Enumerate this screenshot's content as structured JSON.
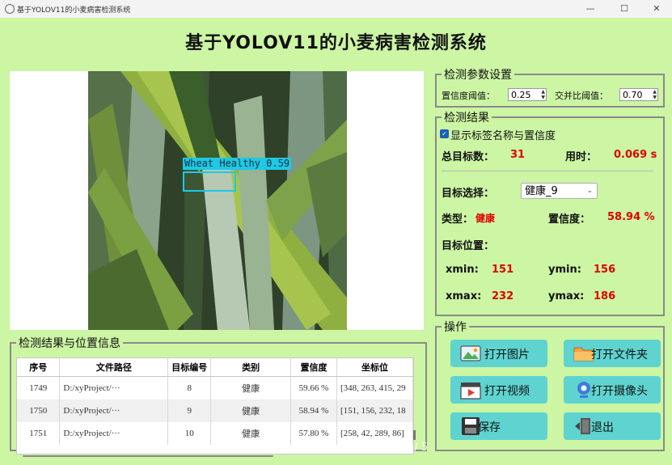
{
  "window": {
    "title": "基于YOLOV11的小麦病害检测系统",
    "min_glyph": "—",
    "max_glyph": "☐",
    "close_glyph": "✕"
  },
  "app": {
    "main_title": "基于YOLOV11的小麦病害检测系统"
  },
  "image": {
    "detection_label": "Wheat Healthy 0.59",
    "box_color": "#1ec8e6"
  },
  "params": {
    "legend": "检测参数设置",
    "conf_label": "置信度阈值：",
    "conf_value": "0.25",
    "iou_label": "交并比阈值：",
    "iou_value": "0.70"
  },
  "results": {
    "legend": "检测结果",
    "show_label_text": "显示标签名称与置信度",
    "show_label_checked": true,
    "total_label": "总目标数：",
    "total_value": "31",
    "time_label": "用时：",
    "time_value": "0.069 s",
    "target_select_label": "目标选择：",
    "target_select_value": "健康_9",
    "type_label": "类型：",
    "type_value": "健康",
    "conf_label": "置信度：",
    "conf_value": "58.94 %",
    "position_label": "目标位置：",
    "xmin_label": "xmin:",
    "xmin_value": "151",
    "ymin_label": "ymin:",
    "ymin_value": "156",
    "xmax_label": "xmax:",
    "xmax_value": "232",
    "ymax_label": "ymax:",
    "ymax_value": "186",
    "accent_color": "#e00000"
  },
  "table": {
    "legend": "检测结果与位置信息",
    "headers": [
      "序号",
      "文件路径",
      "目标编号",
      "类别",
      "置信度",
      "坐标位"
    ],
    "rows": [
      [
        "1749",
        "D:/xyProject/···",
        "8",
        "健康",
        "59.66 %",
        "[348, 263, 415, 29"
      ],
      [
        "1750",
        "D:/xyProject/···",
        "9",
        "健康",
        "58.94 %",
        "[151, 156, 232, 18"
      ],
      [
        "1751",
        "D:/xyProject/···",
        "10",
        "健康",
        "57.80 %",
        "[258, 42, 289, 86]"
      ]
    ]
  },
  "ops": {
    "legend": "操作",
    "open_image": "打开图片",
    "open_folder": "打开文件夹",
    "open_video": "打开视频",
    "open_camera": "打开摄像头",
    "save": "保存",
    "exit": "退出"
  },
  "page_indicator": "4 / 5"
}
